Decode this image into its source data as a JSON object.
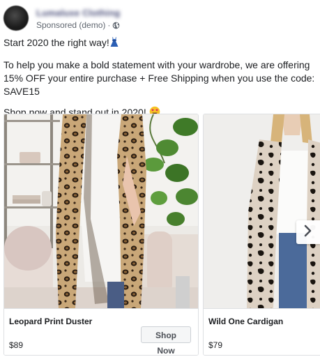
{
  "post": {
    "page_name": "Lumaluxe Clothing",
    "sponsored_label": "Sponsored (demo)",
    "separator": "·",
    "text_line1": "Start 2020 the right way!",
    "text_paragraph2": "To help you make a bold statement with your wardrobe, we are offering 15% OFF your entire purchase + Free Shipping when you use the code: SAVE15",
    "text_line3": "Shop now and stand out in 2020!"
  },
  "carousel": {
    "cards": [
      {
        "title": "Leopard Print Duster",
        "price": "$89",
        "cta": "Shop Now"
      },
      {
        "title": "Wild One Cardigan",
        "price": "$79"
      }
    ]
  },
  "icons": {
    "privacy": "globe-icon",
    "dress": "dress-emoji-icon",
    "star_eyes": "star-struck-emoji-icon",
    "next": "chevron-right-icon"
  },
  "colors": {
    "text": "#1c1e21",
    "muted": "#606770",
    "border": "#dddfe2",
    "button_bg": "#f5f6f7"
  }
}
